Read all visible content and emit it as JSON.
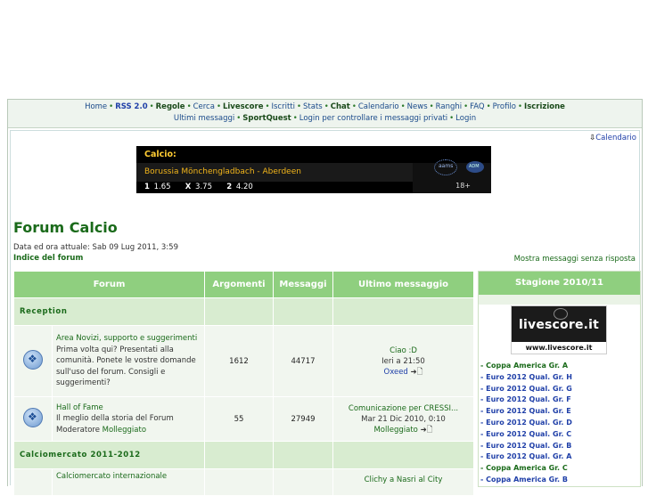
{
  "nav": {
    "row1": [
      {
        "label": "Home",
        "bold": false
      },
      {
        "label": "RSS 2.0",
        "bold": true,
        "blue": true
      },
      {
        "label": "Regole",
        "bold": true
      },
      {
        "label": "Cerca",
        "bold": false
      },
      {
        "label": "Livescore",
        "bold": true
      },
      {
        "label": "Iscritti",
        "bold": false
      },
      {
        "label": "Stats",
        "bold": false
      },
      {
        "label": "Chat",
        "bold": true
      },
      {
        "label": "Calendario",
        "bold": false
      },
      {
        "label": "News",
        "bold": false
      },
      {
        "label": "Ranghi",
        "bold": false
      },
      {
        "label": "FAQ",
        "bold": false
      },
      {
        "label": "Profilo",
        "bold": false
      },
      {
        "label": "Iscrizione",
        "bold": true
      }
    ],
    "row2": [
      {
        "label": "Ultimi messaggi",
        "bold": false
      },
      {
        "label": "SportQuest",
        "bold": true
      },
      {
        "label": "Login per controllare i messaggi privati",
        "bold": false
      },
      {
        "label": "Login",
        "bold": false
      }
    ]
  },
  "calendar_link": "Calendario",
  "banner": {
    "heading": "Calcio:",
    "match": "Borussia Mönchengladbach - Aberdeen",
    "odds": [
      {
        "k": "1",
        "v": "1.65"
      },
      {
        "k": "X",
        "v": "3.75"
      },
      {
        "k": "2",
        "v": "4.20"
      }
    ],
    "age": "18+",
    "logo1": "aams",
    "logo2": "ADM"
  },
  "page_title": "Forum Calcio",
  "datetime": "Data ed ora attuale: Sab 09 Lug 2011, 3:59",
  "index_link": "Indice del forum",
  "unanswered_link": "Mostra messaggi senza risposta",
  "table": {
    "headers": {
      "forum": "Forum",
      "topics": "Argomenti",
      "posts": "Messaggi",
      "last": "Ultimo messaggio"
    },
    "categories": [
      {
        "name": "Reception",
        "forums": [
          {
            "name": "Area Novizi, supporto e suggerimenti",
            "desc": "Prima volta qui? Presentati alla comunità. Ponete le vostre domande sull'uso del forum. Consigli e suggerimenti?",
            "moderator_label": "",
            "moderator": "",
            "topics": "1612",
            "posts": "44717",
            "last_title": "Ciao :D",
            "last_date": "Ieri a 21:50",
            "last_user": "Oxeed"
          },
          {
            "name": "Hall of Fame",
            "desc": "Il meglio della storia del Forum",
            "moderator_label": "Moderatore",
            "moderator": "Molleggiato",
            "topics": "55",
            "posts": "27949",
            "last_title": "Comunicazione per CRESSI...",
            "last_date": "Mar 21 Dic 2010, 0:10",
            "last_user": "Molleggiato"
          }
        ]
      },
      {
        "name": "Calciomercato 2011-2012",
        "forums": [
          {
            "name": "Calciomercato internazionale",
            "last_title": "Clichy a Nasri al City"
          }
        ]
      }
    ]
  },
  "sidebar": {
    "title": "Stagione 2010/11",
    "logo_text": "livescore.it",
    "logo_url": "www.livescore.it",
    "competitions": [
      {
        "label": "- Coppa America Gr. A",
        "blue": false
      },
      {
        "label": "- Euro 2012 Qual. Gr. H",
        "blue": true
      },
      {
        "label": "- Euro 2012 Qual. Gr. G",
        "blue": true
      },
      {
        "label": "- Euro 2012 Qual. Gr. F",
        "blue": true
      },
      {
        "label": "- Euro 2012 Qual. Gr. E",
        "blue": true
      },
      {
        "label": "- Euro 2012 Qual. Gr. D",
        "blue": true
      },
      {
        "label": "- Euro 2012 Qual. Gr. C",
        "blue": true
      },
      {
        "label": "- Euro 2012 Qual. Gr. B",
        "blue": true
      },
      {
        "label": "- Euro 2012 Qual. Gr. A",
        "blue": true
      },
      {
        "label": "- Coppa America Gr. C",
        "blue": false
      },
      {
        "label": "- Coppa America Gr. B",
        "blue": true
      }
    ]
  }
}
